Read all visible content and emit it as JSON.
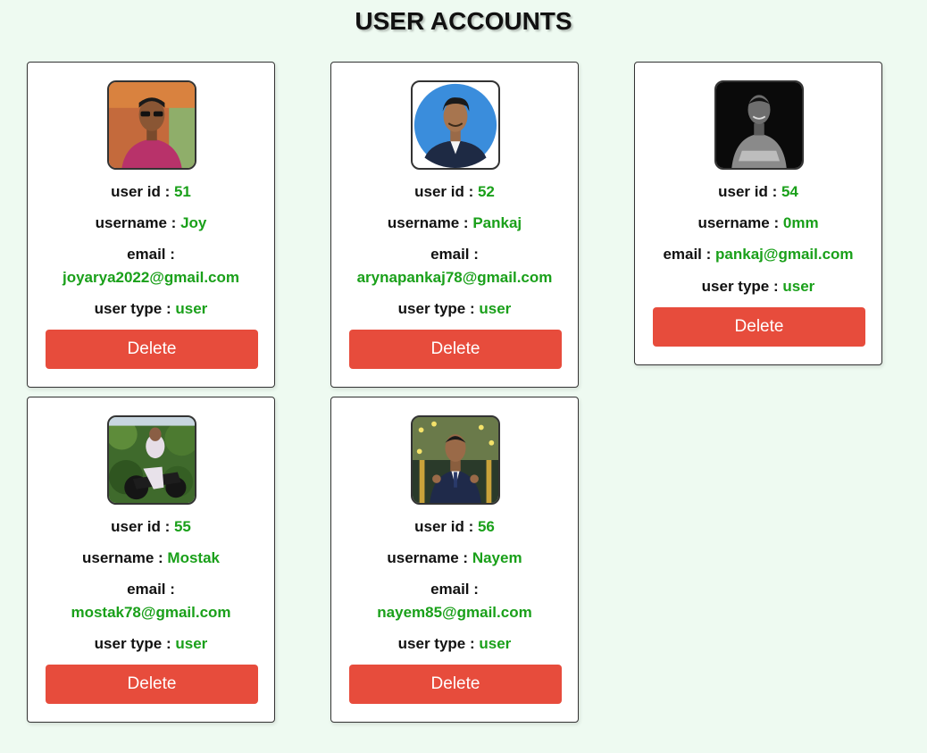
{
  "page": {
    "title": "USER ACCOUNTS"
  },
  "labels": {
    "user_id": "user id :",
    "username": "username :",
    "email": "email :",
    "user_type": "user type :",
    "delete": "Delete"
  },
  "colors": {
    "background": "#eefaf1",
    "value_green": "#1aa01a",
    "delete_red": "#e74c3c"
  },
  "users": [
    {
      "user_id": "51",
      "username": "Joy",
      "email": "joyarya2022@gmail.com",
      "user_type": "user",
      "avatar": "photo-man-sunglasses"
    },
    {
      "user_id": "52",
      "username": "Pankaj",
      "email": "arynapankaj78@gmail.com",
      "user_type": "user",
      "avatar": "photo-man-blue-background"
    },
    {
      "user_id": "54",
      "username": "0mm",
      "email": "pankaj@gmail.com",
      "user_type": "user",
      "avatar": "photo-man-black-and-white"
    },
    {
      "user_id": "55",
      "username": "Mostak",
      "email": "mostak78@gmail.com",
      "user_type": "user",
      "avatar": "photo-man-motorcycle"
    },
    {
      "user_id": "56",
      "username": "Nayem",
      "email": "nayem85@gmail.com",
      "user_type": "user",
      "avatar": "photo-man-suit-thumbs-up"
    }
  ]
}
